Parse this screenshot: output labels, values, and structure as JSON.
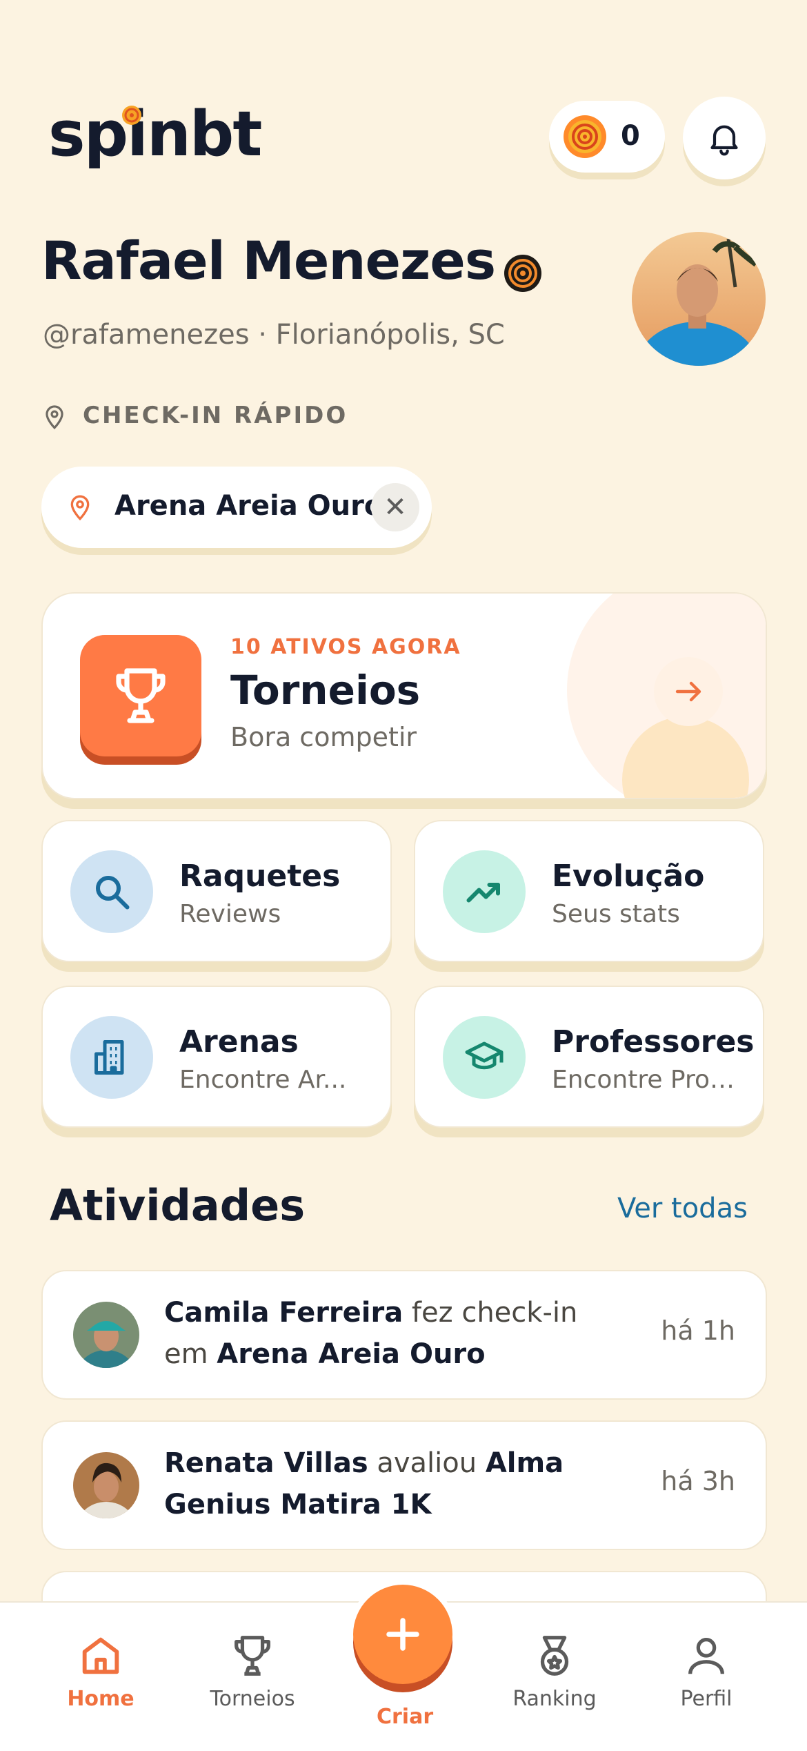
{
  "app": {
    "logo": "spinbt"
  },
  "header": {
    "coins": "0"
  },
  "profile": {
    "name": "Rafael Menezes",
    "handle": "@rafamenezes · Florianópolis, SC"
  },
  "checkin": {
    "label": "CHECK-IN RÁPIDO",
    "arena": "Arena Areia Ouro",
    "clear_glyph": "✕"
  },
  "featured": {
    "kicker": "10 ATIVOS AGORA",
    "title": "Torneios",
    "subtitle": "Bora competir"
  },
  "tiles": [
    {
      "title": "Raquetes",
      "subtitle": "Reviews",
      "icon": "search-icon"
    },
    {
      "title": "Evolução",
      "subtitle": "Seus stats",
      "icon": "trend-up-icon"
    },
    {
      "title": "Arenas",
      "subtitle": "Encontre Ar...",
      "icon": "building-icon"
    },
    {
      "title": "Professores",
      "subtitle": "Encontre Prof...",
      "icon": "graduation-cap-icon"
    }
  ],
  "activities": {
    "title": "Atividades",
    "see_all": "Ver todas",
    "items": [
      {
        "user": "Camila Ferreira",
        "action": " fez check-in em ",
        "target": "Arena Areia Ouro",
        "time": "há 1h"
      },
      {
        "user": "Renata Villas",
        "action": " avaliou ",
        "target": "Alma Genius Matira 1K",
        "time": "há 3h"
      }
    ]
  },
  "nav": {
    "home": "Home",
    "tournaments": "Torneios",
    "create": "Criar",
    "ranking": "Ranking",
    "profile": "Perfil"
  },
  "colors": {
    "background": "#FCF3E1",
    "accent": "#F0713F",
    "link": "#1A6C9C",
    "text": "#141B2D"
  }
}
